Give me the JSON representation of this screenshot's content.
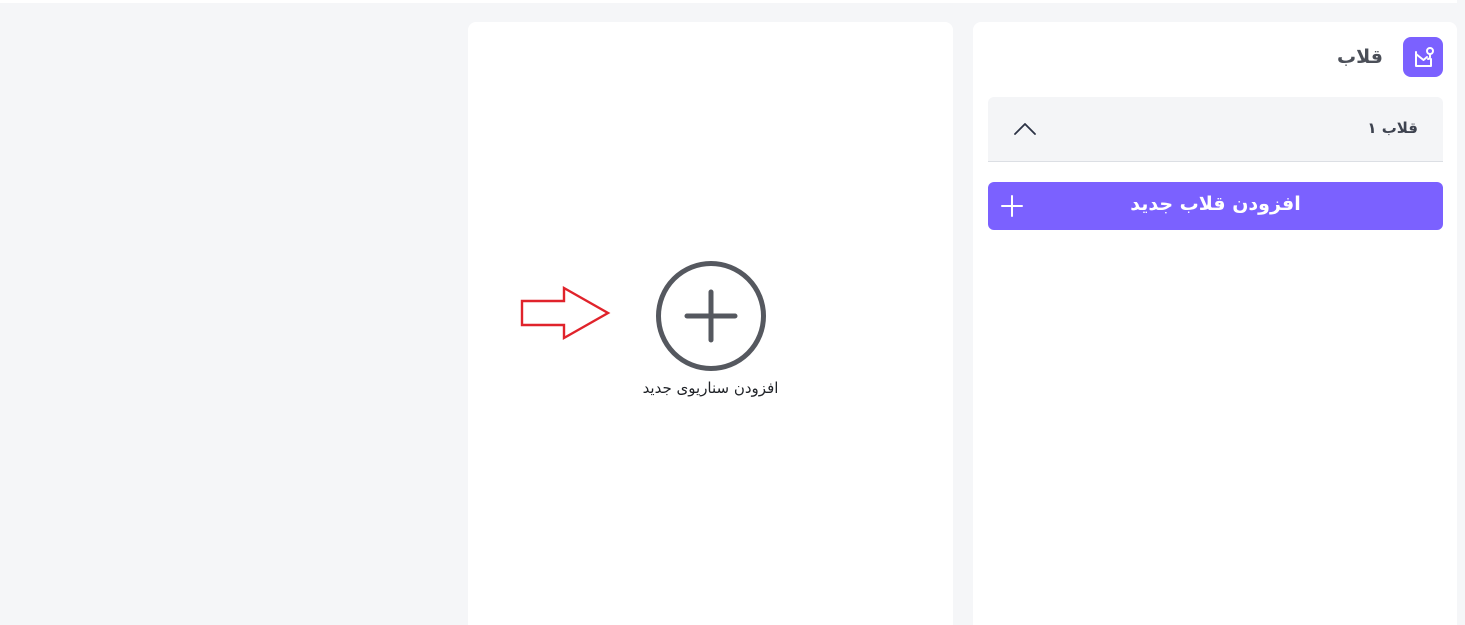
{
  "hook_panel": {
    "title": "قلاب",
    "header_icon": "hook-template-icon",
    "items": [
      {
        "label": "قلاب ۱",
        "expanded": true,
        "toggle_icon": "chevron-up-icon"
      }
    ],
    "add_button": {
      "label": "افزودن قلاب جدید",
      "icon": "plus-icon"
    }
  },
  "scenario_panel": {
    "add_label": "افزودن سناریوی جدید",
    "add_icon": "plus-circle-icon",
    "pointer_icon": "arrow-right-outline-icon"
  },
  "colors": {
    "accent": "#7b61ff",
    "page_background": "#f5f6f8",
    "panel_background": "#ffffff",
    "item_background": "#f4f5f7",
    "icon_gray": "#55585f",
    "pointer_red": "#e0232b"
  }
}
